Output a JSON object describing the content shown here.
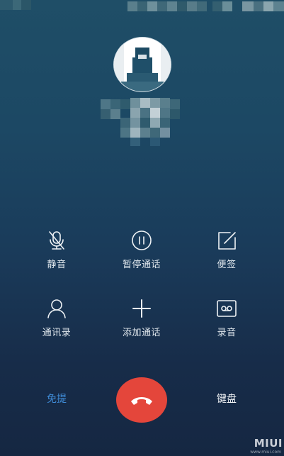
{
  "controls": [
    {
      "label": "静音",
      "icon": "mute-mic-icon"
    },
    {
      "label": "暂停通话",
      "icon": "pause-icon"
    },
    {
      "label": "便签",
      "icon": "note-edit-icon"
    },
    {
      "label": "通讯录",
      "icon": "contact-person-icon"
    },
    {
      "label": "添加通话",
      "icon": "plus-icon"
    },
    {
      "label": "录音",
      "icon": "voicemail-record-icon"
    }
  ],
  "bottom": {
    "speaker_label": "免提",
    "keypad_label": "键盘",
    "hangup_icon": "phone-hangup-icon"
  },
  "watermark": {
    "logo_text": "MIUI",
    "sub_text": "www.miui.com"
  },
  "colors": {
    "hangup": "#e4463b",
    "speaker_active": "#3f8bd6",
    "background_top": "#1f4e67",
    "background_bottom": "#152742"
  }
}
